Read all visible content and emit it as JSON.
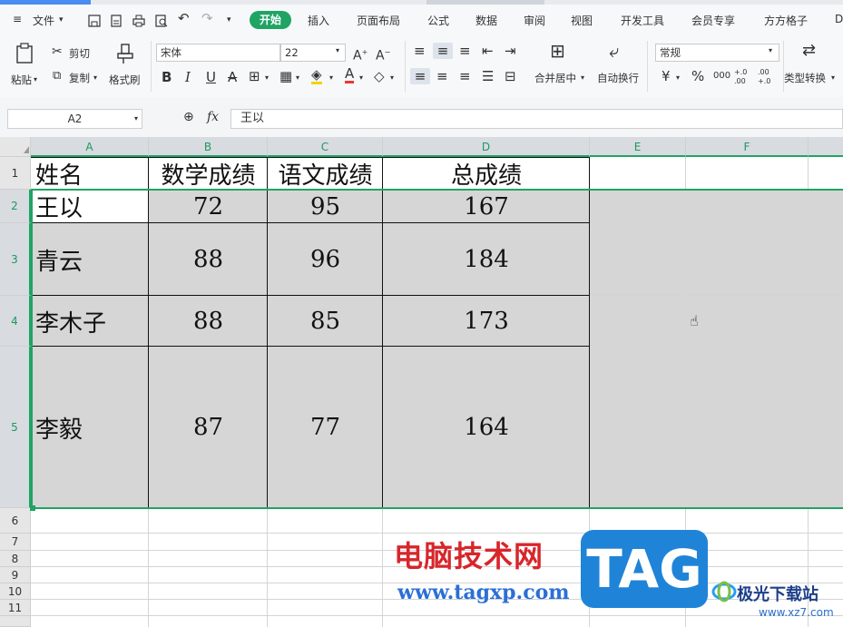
{
  "menu": {
    "file_label": "文件",
    "tabs": [
      {
        "label": "开始"
      },
      {
        "label": "插入"
      },
      {
        "label": "页面布局"
      },
      {
        "label": "公式"
      },
      {
        "label": "数据"
      },
      {
        "label": "审阅"
      },
      {
        "label": "视图"
      },
      {
        "label": "开发工具"
      },
      {
        "label": "会员专享"
      },
      {
        "label": "方方格子"
      },
      {
        "label": "D"
      }
    ]
  },
  "ribbon": {
    "paste": "粘贴",
    "cut": "剪切",
    "copy": "复制",
    "format_painter": "格式刷",
    "font_name": "宋体",
    "font_size": "22",
    "merge_center": "合并居中",
    "wrap_text": "自动换行",
    "number_format": "常规",
    "type_convert": "类型转换",
    "currency_symbol": "¥",
    "percent_symbol": "%",
    "thousands_symbol": "000",
    "dec_increase": "+.0 .00",
    "dec_decrease": ".00 +.0"
  },
  "formula_bar": {
    "cell_ref": "A2",
    "fx": "fx",
    "content": "王以"
  },
  "columns": [
    "A",
    "B",
    "C",
    "D",
    "E",
    "F"
  ],
  "rows": [
    "1",
    "2",
    "3",
    "4",
    "5",
    "6",
    "7",
    "8",
    "9",
    "10",
    "11"
  ],
  "table": {
    "headers": [
      "姓名",
      "数学成绩",
      "语文成绩",
      "总成绩"
    ],
    "data": [
      [
        "王以",
        "72",
        "95",
        "167"
      ],
      [
        "青云",
        "88",
        "96",
        "184"
      ],
      [
        "李木子",
        "88",
        "85",
        "173"
      ],
      [
        "李毅",
        "87",
        "77",
        "164"
      ]
    ]
  },
  "watermark": {
    "site_cn": "电脑技术网",
    "site_url": "www.tagxp.com",
    "tag": "TAG",
    "logo_cn": "极光下载站",
    "logo_url": "www.xz7.com"
  },
  "colors": {
    "accent": "#1fa463",
    "selection_fill": "#d6d6d6"
  }
}
